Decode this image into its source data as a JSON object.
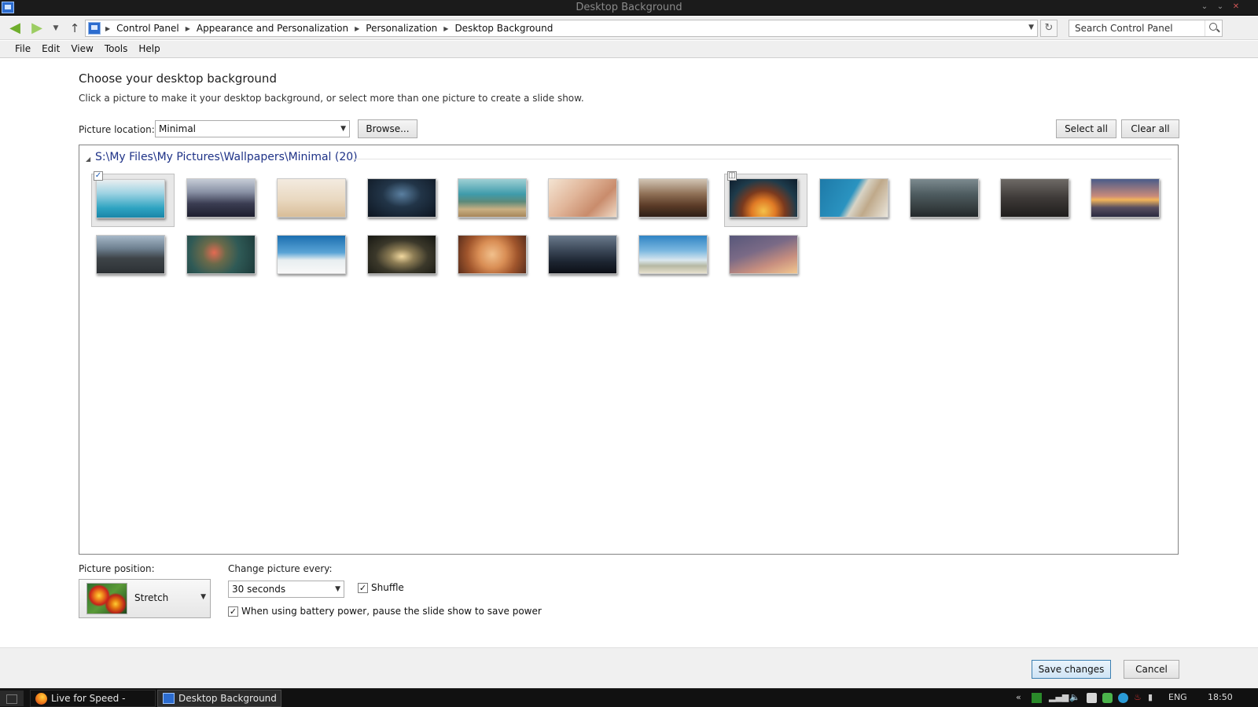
{
  "window": {
    "title": "Desktop Background",
    "controls": [
      "⌄",
      "⌄",
      "✕"
    ]
  },
  "navigation": {
    "breadcrumbs": [
      "Control Panel",
      "Appearance and Personalization",
      "Personalization",
      "Desktop Background"
    ],
    "search_placeholder": "Search Control Panel"
  },
  "menu": [
    "File",
    "Edit",
    "View",
    "Tools",
    "Help"
  ],
  "main": {
    "heading": "Choose your desktop background",
    "subheading": "Click a picture to make it your desktop background, or select more than one picture to create a slide show.",
    "picture_location_label": "Picture location:",
    "picture_location_value": "Minimal",
    "browse_label": "Browse...",
    "select_all_label": "Select all",
    "clear_all_label": "Clear all",
    "group_title": "S:\\My Files\\My Pictures\\Wallpapers\\Minimal (20)",
    "thumbnails": [
      {
        "name": "wallpaper-01",
        "checked": true
      },
      {
        "name": "wallpaper-02",
        "checked": false
      },
      {
        "name": "wallpaper-03",
        "checked": false
      },
      {
        "name": "wallpaper-04",
        "checked": false
      },
      {
        "name": "wallpaper-05",
        "checked": false
      },
      {
        "name": "wallpaper-06",
        "checked": false
      },
      {
        "name": "wallpaper-07",
        "checked": false
      },
      {
        "name": "wallpaper-08",
        "checked": false
      },
      {
        "name": "wallpaper-09",
        "checked": false
      },
      {
        "name": "wallpaper-10",
        "checked": false
      },
      {
        "name": "wallpaper-11",
        "checked": false
      },
      {
        "name": "wallpaper-12",
        "checked": false
      },
      {
        "name": "wallpaper-13",
        "checked": false
      },
      {
        "name": "wallpaper-14",
        "checked": false
      },
      {
        "name": "wallpaper-15",
        "checked": false
      },
      {
        "name": "wallpaper-16",
        "checked": false
      },
      {
        "name": "wallpaper-17",
        "checked": false
      },
      {
        "name": "wallpaper-18",
        "checked": false
      },
      {
        "name": "wallpaper-19",
        "checked": false
      },
      {
        "name": "wallpaper-20",
        "checked": false
      }
    ]
  },
  "options": {
    "position_label": "Picture position:",
    "position_value": "Stretch",
    "change_every_label": "Change picture every:",
    "change_every_value": "30 seconds",
    "shuffle_label": "Shuffle",
    "shuffle_checked": true,
    "battery_label": "When using battery power, pause the slide show to save power",
    "battery_checked": true
  },
  "footer": {
    "save_label": "Save changes",
    "cancel_label": "Cancel"
  },
  "taskbar": {
    "tasks": [
      "Live for Speed - Repl...",
      "Desktop Background"
    ],
    "language": "ENG",
    "time": "18:50"
  }
}
